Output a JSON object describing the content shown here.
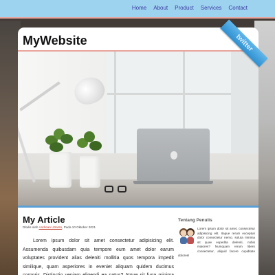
{
  "nav": {
    "items": [
      "Home",
      "About",
      "Product",
      "Services",
      "Contact"
    ]
  },
  "site": {
    "title": "MyWebsite"
  },
  "ribbon": {
    "label": "twitter",
    "color": "#3a9ad9"
  },
  "article": {
    "title": "My Article",
    "meta_prefix": "Ditulis oleh",
    "author": "Andrean Utranto",
    "meta_suffix": ", Pada 10 Oktober 2021",
    "body": "Lorem ipsum dolor sit amet consectetur adipisicing elit. Assumenda quibusdam quia tempore eum amet dolor earum voluptates provident alias deleniti mollitia quos tempora impedit similique, quam asperiores in eveniet aliquam quidem ducimus corporis. Distinctio veniam eligendi ea natus? Atque sit fuga minima velit obcaecati itaque perspiciatis aut dignissimos, quam explicabo!"
  },
  "sidebar": {
    "title": "Tentang Penulis",
    "avatar_icon": "couple-cartoon-avatar",
    "text": "Lorem ipsum dolor sit amet, consectetur adipisicing elit. Itaque rerum excepturi dolor consectetur nemo, soluta minima sit quae expedita deleniti, nobis maiores? Numquam rerum libero consectetur, aliquid facere cupiditate dolores!"
  },
  "colors": {
    "navbar": "#9ed3f0",
    "accent_rule": "#e9a39a",
    "nav_link": "#3a3aa0",
    "hero_rule": "#5aa0d6"
  }
}
